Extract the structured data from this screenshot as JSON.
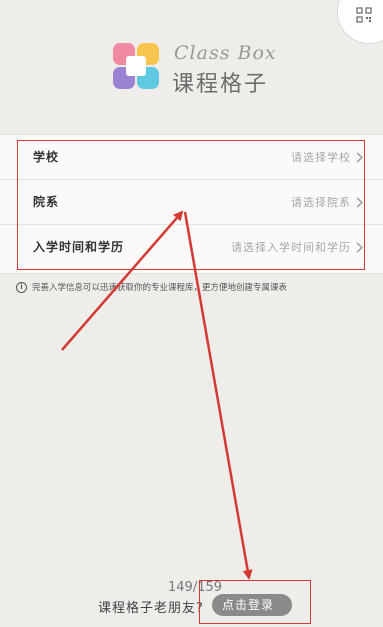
{
  "header": {
    "brand_en": "Class Box",
    "brand_cn": "课程格子",
    "qr_icon": "qr-code-icon"
  },
  "form": {
    "rows": [
      {
        "label": "学校",
        "placeholder": "请选择学校"
      },
      {
        "label": "院系",
        "placeholder": "请选择院系"
      },
      {
        "label": "入学时间和学历",
        "placeholder": "请选择入学时间和学历"
      }
    ]
  },
  "info": {
    "icon": "info-icon",
    "text": "完善入学信息可以迅速获取你的专业课程库，更方便地创建专属课表"
  },
  "footer": {
    "counter": "149/159",
    "question": "课程格子老朋友?",
    "login_label": "点击登录"
  },
  "colors": {
    "annotation": "#d33a33",
    "background": "#efedea"
  }
}
